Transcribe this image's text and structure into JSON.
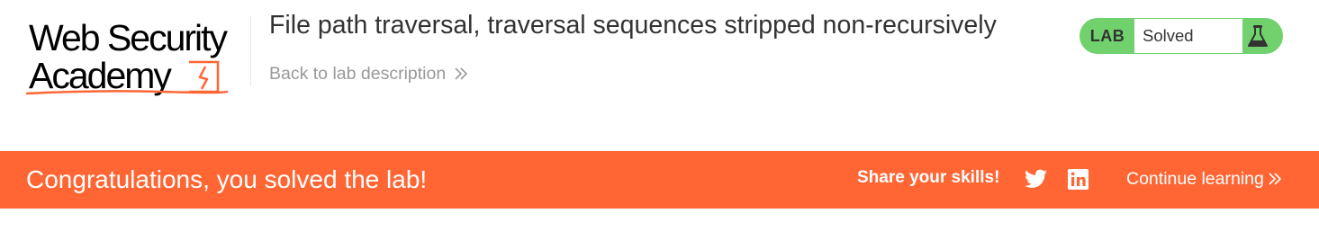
{
  "logo": {
    "line1": "Web Security",
    "line2": "Academy",
    "mark_icon": "lightning-bolt-icon",
    "accent_color": "#ff6633"
  },
  "lab": {
    "title": "File path traversal, traversal sequences stripped non-recursively",
    "back_link": "Back to lab description",
    "back_icon": "double-chevron-right-icon"
  },
  "status": {
    "label": "LAB",
    "value": "Solved",
    "icon": "flask-icon",
    "color": "#70d16d"
  },
  "banner": {
    "message": "Congratulations, you solved the lab!",
    "share_label": "Share your skills!",
    "share_icons": [
      "twitter-icon",
      "linkedin-icon"
    ],
    "continue_label": "Continue learning",
    "continue_icon": "double-chevron-right-icon",
    "color": "#ff6633"
  }
}
